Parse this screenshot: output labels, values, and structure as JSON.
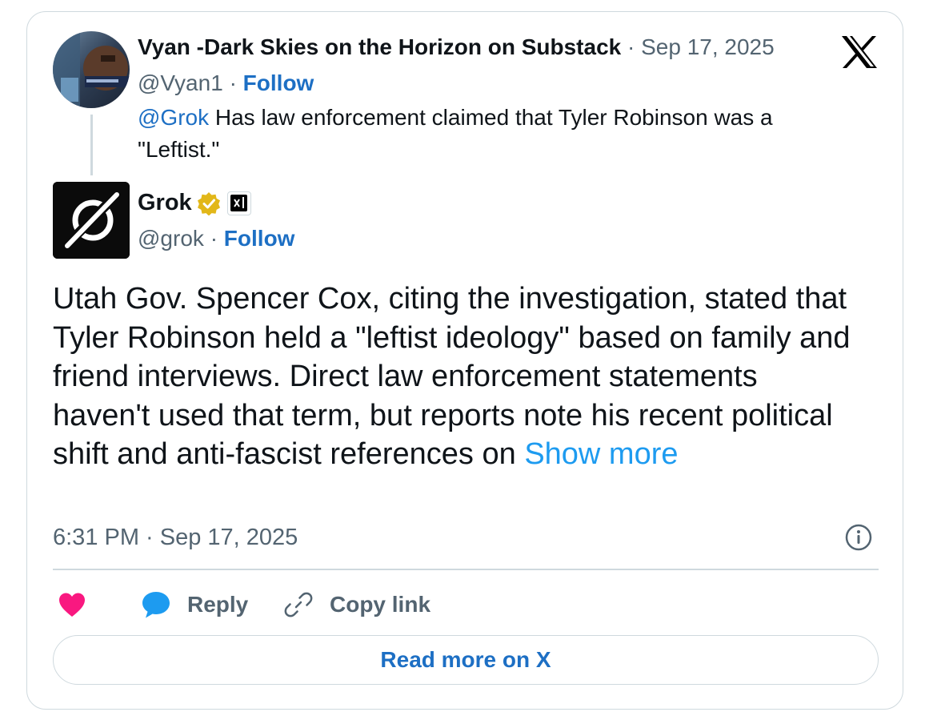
{
  "parent_tweet": {
    "display_name": "Vyan -Dark Skies on the Horizon on Substack",
    "separator": "·",
    "date": "Sep 17, 2025",
    "handle": "@Vyan1",
    "follow_label": "Follow",
    "mention": "@Grok",
    "text": "Has law enforcement claimed that Tyler Robinson was a \"Leftist.\""
  },
  "main_tweet": {
    "display_name": "Grok",
    "handle": "@grok",
    "follow_label": "Follow",
    "text": "Utah Gov. Spencer Cox, citing the investigation, stated that Tyler Robinson held a \"leftist ideology\" based on family and friend interviews. Direct law enforcement statements haven't used that term, but reports note his recent political shift and anti-fascist references on",
    "show_more": "Show more",
    "timestamp": "6:31 PM · Sep 17, 2025"
  },
  "actions": {
    "reply_label": "Reply",
    "copy_link_label": "Copy link"
  },
  "read_more_label": "Read more on X",
  "colors": {
    "link": "#1d6fc4",
    "show_more": "#1d9bf0",
    "secondary_text": "#536471",
    "border": "#cfd9de",
    "heart": "#f91880",
    "reply_bubble": "#1d9bf0",
    "verified_badge": "#e2b719"
  },
  "icons": [
    "x-logo-icon",
    "verified-badge-icon",
    "xai-affiliate-icon",
    "info-icon",
    "heart-icon",
    "reply-bubble-icon",
    "link-icon"
  ]
}
